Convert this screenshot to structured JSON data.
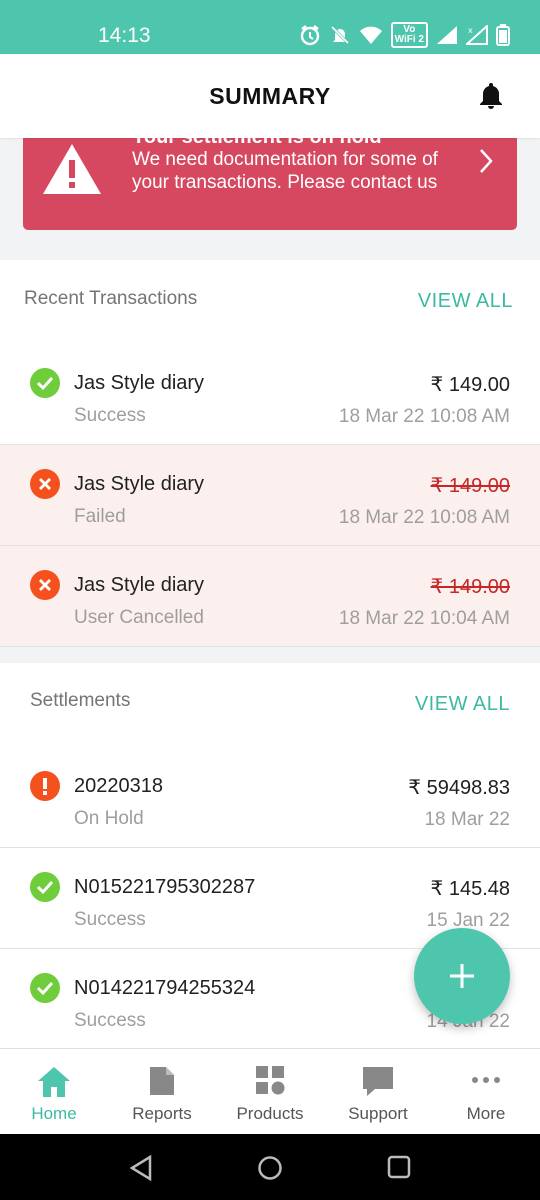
{
  "status_bar": {
    "time": "14:13",
    "volte": "Vo\nWiFi 2"
  },
  "header": {
    "title": "SUMMARY"
  },
  "alert": {
    "title": "Your settlement is on hold",
    "message": "We need documentation for some of your transactions. Please contact us"
  },
  "transactions": {
    "title": "Recent Transactions",
    "view_all": "VIEW ALL",
    "items": [
      {
        "name": "Jas Style diary",
        "status": "Success",
        "amount": "₹ 149.00",
        "date": "18 Mar 22 10:08 AM",
        "state": "success"
      },
      {
        "name": "Jas Style diary",
        "status": "Failed",
        "amount": "₹ 149.00",
        "date": "18 Mar 22 10:08 AM",
        "state": "failed"
      },
      {
        "name": "Jas Style diary",
        "status": "User Cancelled",
        "amount": "₹ 149.00",
        "date": "18 Mar 22 10:04 AM",
        "state": "failed"
      }
    ]
  },
  "settlements": {
    "title": "Settlements",
    "view_all": "VIEW ALL",
    "items": [
      {
        "id": "20220318",
        "status": "On Hold",
        "amount": "₹ 59498.83",
        "date": "18 Mar 22",
        "state": "hold"
      },
      {
        "id": "N015221795302287",
        "status": "Success",
        "amount": "₹ 145.48",
        "date": "15 Jan 22",
        "state": "success"
      },
      {
        "id": "N014221794255324",
        "status": "Success",
        "amount": "",
        "date": "14 Jan 22",
        "state": "success"
      }
    ]
  },
  "bottom_nav": {
    "items": [
      {
        "label": "Home",
        "icon": "home-icon",
        "active": true
      },
      {
        "label": "Reports",
        "icon": "document-icon",
        "active": false
      },
      {
        "label": "Products",
        "icon": "grid-icon",
        "active": false
      },
      {
        "label": "Support",
        "icon": "chat-icon",
        "active": false
      },
      {
        "label": "More",
        "icon": "more-icon",
        "active": false
      }
    ]
  },
  "colors": {
    "accent": "#4ec6ad",
    "alert": "#d6485f",
    "success": "#6fcc3a",
    "error": "#f4511e"
  }
}
